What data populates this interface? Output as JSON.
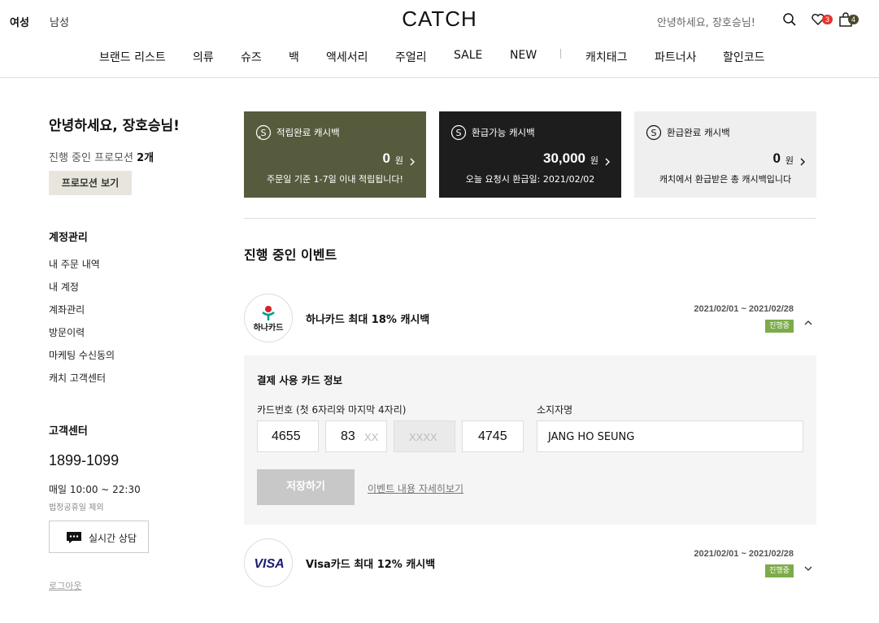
{
  "header": {
    "gender_tabs": [
      "여성",
      "남성"
    ],
    "logo": "CATCH",
    "greeting": "안녕하세요, 장호승님!",
    "wishlist_count": "3",
    "cart_count": "4",
    "nav": [
      "브랜드 리스트",
      "의류",
      "슈즈",
      "백",
      "액세서리",
      "주얼리",
      "SALE",
      "NEW",
      "캐치태그",
      "파트너사",
      "할인코드"
    ]
  },
  "sidebar": {
    "hello": "안녕하세요, 장호승님!",
    "promo_label": "진행 중인 프로모션",
    "promo_count": "2개",
    "promo_button": "프로모션 보기",
    "account_heading": "계정관리",
    "account_links": [
      "내 주문 내역",
      "내 계정",
      "계좌관리",
      "방문이력",
      "마케팅 수신동의",
      "캐치 고객센터"
    ],
    "support_heading": "고객센터",
    "phone": "1899-1099",
    "hours": "매일 10:00 ~ 22:30",
    "holiday_note": "법정공휴일 제외",
    "chat_button": "실시간 상담",
    "logout": "로그아웃"
  },
  "cards": [
    {
      "title": "적립완료 캐시백",
      "amount": "0",
      "unit": "원",
      "note": "주문일 기준 1-7일 이내 적립됩니다!"
    },
    {
      "title": "환급가능 캐시백",
      "amount": "30,000",
      "unit": "원",
      "note": "오늘 요청시 환급일: 2021/02/02"
    },
    {
      "title": "환급완료 캐시백",
      "amount": "0",
      "unit": "원",
      "note": "캐치에서 환급받은 총 캐시백입니다"
    }
  ],
  "events_title": "진행 중인 이벤트",
  "events": [
    {
      "logo_text": "하나카드",
      "name": "하나카드 최대 18% 캐시백",
      "period": "2021/02/01 ~ 2021/02/28",
      "status": "진행중"
    },
    {
      "logo_text": "VISA",
      "name": "Visa카드 최대 12% 캐시백",
      "period": "2021/02/01 ~ 2021/02/28",
      "status": "진행중"
    }
  ],
  "card_form": {
    "heading": "결제 사용 카드 정보",
    "card_number_label": "카드번호 (첫 6자리와 마지막 4자리)",
    "holder_label": "소지자명",
    "seg1": "4655",
    "seg2": "83",
    "seg2_placeholder": "XX",
    "seg3_placeholder": "XXXX",
    "seg4": "4745",
    "holder_value": "JANG HO SEUNG",
    "save_button": "저장하기",
    "detail_link": "이벤트 내용 자세히보기"
  },
  "colors": {
    "card_green": "#575b3d",
    "card_dark": "#1d1d1d",
    "card_light": "#efefef",
    "status_green": "#7cab4a",
    "badge_red": "#e5322d"
  }
}
